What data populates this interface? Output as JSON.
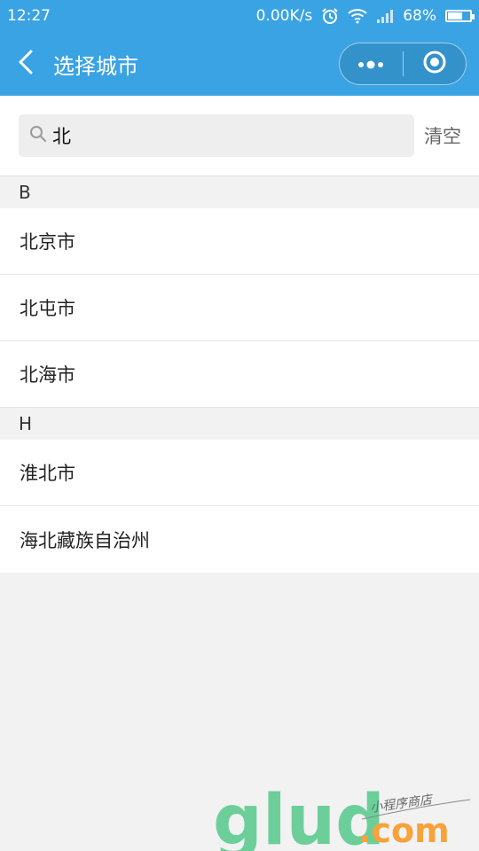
{
  "status_bar": {
    "time": "12:27",
    "net_speed": "0.00K/s",
    "battery_percent": "68%",
    "battery_level": 0.68
  },
  "nav": {
    "title": "选择城市",
    "back_icon": "chevron-left-icon",
    "more_icon": "more-dots-icon",
    "close_icon": "target-circle-icon"
  },
  "search": {
    "value": "北",
    "clear_label": "清空"
  },
  "sections": [
    {
      "letter": "B",
      "cities": [
        "北京市",
        "北屯市",
        "北海市"
      ]
    },
    {
      "letter": "H",
      "cities": [
        "淮北市",
        "海北藏族自治州"
      ]
    }
  ],
  "watermark": {
    "logo_text": "glud",
    "domain": ".com",
    "tagline": "小程序商店"
  },
  "colors": {
    "primary": "#3aa3e3",
    "watermark_green": "#6ccf9a",
    "watermark_orange": "#f7a23b"
  }
}
